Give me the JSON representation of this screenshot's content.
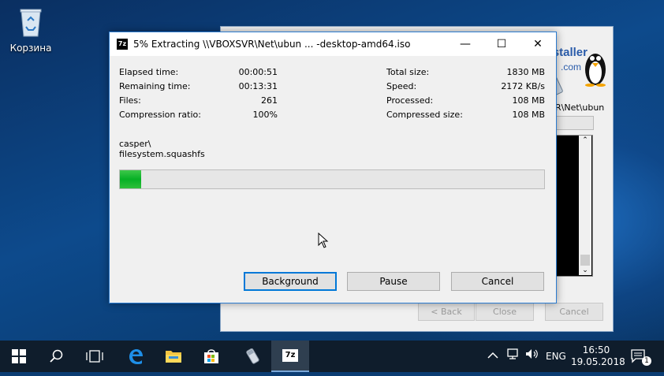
{
  "desktop": {
    "recycle_bin_label": "Корзина"
  },
  "background_window": {
    "logo_text_1": "staller",
    "logo_text_2": ".com",
    "path_text": "R\\Net\\ubun",
    "buttons": {
      "back": "< Back",
      "close": "Close",
      "cancel": "Cancel"
    }
  },
  "dialog": {
    "title": "5% Extracting \\\\VBOXSVR\\Net\\ubun ... -desktop-amd64.iso",
    "app_icon_text": "7z",
    "window_controls": {
      "minimize": "—",
      "maximize": "☐",
      "close": "✕"
    },
    "left_stats": [
      {
        "label": "Elapsed time:",
        "value": "00:00:51"
      },
      {
        "label": "Remaining time:",
        "value": "00:13:31"
      },
      {
        "label": "Files:",
        "value": "261"
      },
      {
        "label": "Compression ratio:",
        "value": "100%"
      }
    ],
    "right_stats": [
      {
        "label": "Total size:",
        "value": "1830 MB"
      },
      {
        "label": "Speed:",
        "value": "2172 KB/s"
      },
      {
        "label": "Processed:",
        "value": "108 MB"
      },
      {
        "label": "Compressed size:",
        "value": "108 MB"
      }
    ],
    "current_path_line1": "casper\\",
    "current_path_line2": "filesystem.squashfs",
    "progress_percent": 5,
    "buttons": {
      "background": "Background",
      "pause": "Pause",
      "cancel": "Cancel"
    }
  },
  "taskbar": {
    "language": "ENG",
    "time": "16:50",
    "date": "19.05.2018",
    "notification_count": "1",
    "colors": {
      "taskbar_bg": "#0f1d2c",
      "progress_green": "#06b025",
      "accent": "#0078d7"
    }
  }
}
